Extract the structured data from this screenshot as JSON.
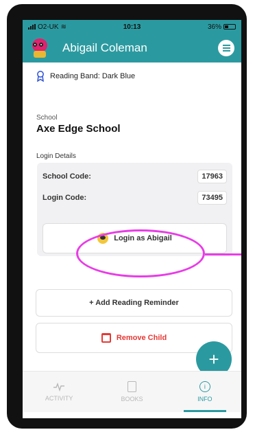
{
  "status_bar": {
    "carrier": "O2-UK",
    "time": "10:13",
    "battery": "36%"
  },
  "header": {
    "title": "Abigail Coleman"
  },
  "reading_band": {
    "label": "Reading Band: Dark Blue"
  },
  "school": {
    "label": "School",
    "name": "Axe Edge School"
  },
  "login_details": {
    "label": "Login Details",
    "school_code_label": "School Code:",
    "school_code": "17963",
    "login_code_label": "Login Code:",
    "login_code": "73495",
    "login_button": "Login as Abigail"
  },
  "actions": {
    "add_reminder": "+ Add Reading Reminder",
    "remove_child": "Remove Child",
    "fab": "+"
  },
  "nav": [
    {
      "label": "ACTIVITY"
    },
    {
      "label": "BOOKS"
    },
    {
      "label": "INFO"
    }
  ],
  "colors": {
    "accent": "#2b9aa0",
    "highlight": "#e83ce6",
    "danger": "#e53935"
  }
}
